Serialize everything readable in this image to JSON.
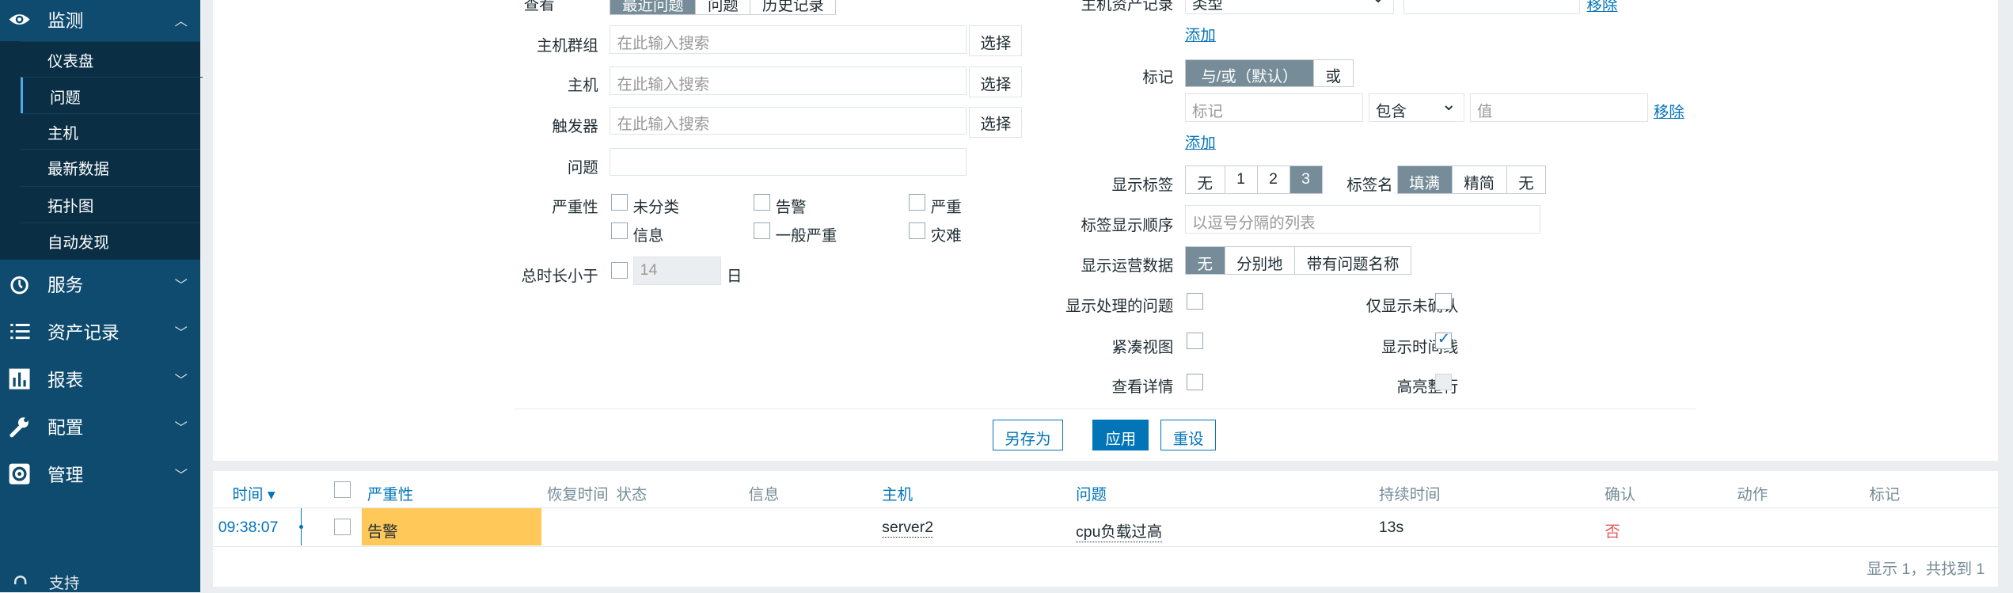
{
  "sidebar": {
    "monitoring": "监测",
    "monitoring_items": [
      "仪表盘",
      "问题",
      "主机",
      "最新数据",
      "拓扑图",
      "自动发现"
    ],
    "services": "服务",
    "inventory": "资产记录",
    "reports": "报表",
    "config": "配置",
    "admin": "管理",
    "support": "支持"
  },
  "filter": {
    "show_label": "查看",
    "show_options": [
      "最近问题",
      "问题",
      "历史记录"
    ],
    "hostgroup_label": "主机群组",
    "host_label": "主机",
    "trigger_label": "触发器",
    "problem_label": "问题",
    "search_placeholder": "在此输入搜索",
    "select_btn": "选择",
    "severity_label": "严重性",
    "severities": [
      "未分类",
      "告警",
      "严重",
      "信息",
      "一般严重",
      "灾难"
    ],
    "age_label": "总时长小于",
    "age_value": "14",
    "age_unit": "日",
    "inventory_label": "主机资产记录",
    "inventory_type": "类型",
    "remove": "移除",
    "add": "添加",
    "tags_label": "标记",
    "tags_mode": [
      "与/或（默认）",
      "或"
    ],
    "tag_placeholder": "标记",
    "tag_operator": "包含",
    "value_placeholder": "值",
    "show_tags_label": "显示标签",
    "show_tags_options": [
      "无",
      "1",
      "2",
      "3"
    ],
    "tag_name_label": "标签名",
    "tag_name_options": [
      "填满",
      "精简",
      "无"
    ],
    "tag_priority_label": "标签显示顺序",
    "tag_priority_placeholder": "以逗号分隔的列表",
    "show_opdata_label": "显示运营数据",
    "show_opdata_options": [
      "无",
      "分别地",
      "带有问题名称"
    ],
    "show_suppressed": "显示处理的问题",
    "unack_only": "仅显示未确认",
    "compact": "紧凑视图",
    "timeline": "显示时间线",
    "details": "查看详情",
    "highlight": "高亮整行",
    "save_as": "另存为",
    "apply": "应用",
    "reset": "重设"
  },
  "table": {
    "headers": [
      "时间 ▾",
      "严重性",
      "恢复时间",
      "状态",
      "信息",
      "主机",
      "问题",
      "持续时间",
      "确认",
      "动作",
      "标记"
    ],
    "rows": [
      {
        "time": "09:38:07",
        "severity": "告警",
        "host": "server2",
        "problem": "cpu负载过高",
        "duration": "13s",
        "ack": "否"
      }
    ],
    "footer": "显示 1，共找到 1"
  },
  "colors": {
    "sidebar": "#0e4b6e",
    "accent": "#0275b8",
    "warning": "#ffc859",
    "ack_no": "#e45959"
  }
}
